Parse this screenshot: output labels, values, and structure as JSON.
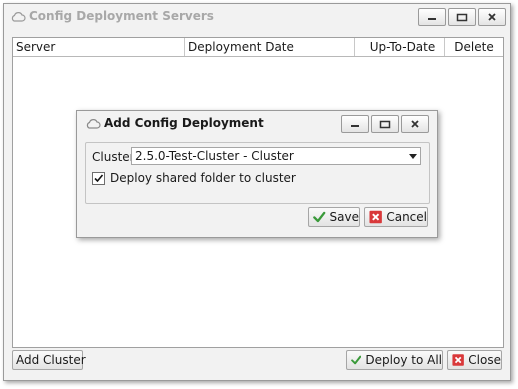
{
  "window": {
    "title": "Config Deployment Servers",
    "icon": "cloud-icon"
  },
  "grid": {
    "columns": [
      "Server",
      "Deployment Date",
      "Up-To-Date",
      "Delete"
    ],
    "rows": []
  },
  "footer": {
    "add_cluster_label": "Add Cluster",
    "deploy_all_label": "Deploy to All",
    "close_label": "Close"
  },
  "dialog": {
    "title": "Add Config Deployment",
    "cluster_label": "Cluster",
    "cluster_value": "2.5.0-Test-Cluster - Cluster",
    "deploy_shared_label": "Deploy shared folder to cluster",
    "deploy_shared_checked": true,
    "save_label": "Save",
    "cancel_label": "Cancel"
  },
  "colors": {
    "save_check": "#3a9a3a",
    "cancel_red": "#d9383a"
  }
}
